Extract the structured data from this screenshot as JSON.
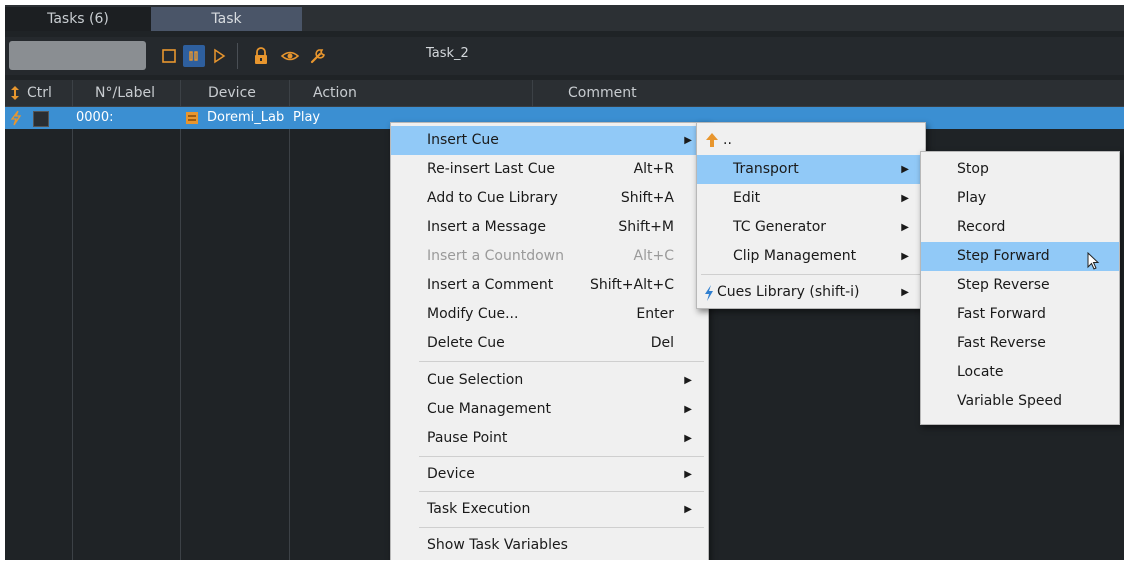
{
  "tabs": [
    "Tasks (6)",
    "Task"
  ],
  "toolbar": {
    "task_name": "Task_2"
  },
  "columns": {
    "ctrl": "Ctrl",
    "label": "N°/Label",
    "device": "Device",
    "action": "Action",
    "comment": "Comment"
  },
  "row": {
    "label": "0000:",
    "device": "Doremi_Lab",
    "action": "Play"
  },
  "context_menu": {
    "items": [
      {
        "label": "Insert Cue",
        "shortcut": ""
      },
      {
        "label": "Re-insert Last Cue",
        "shortcut": "Alt+R"
      },
      {
        "label": "Add to Cue Library",
        "shortcut": "Shift+A"
      },
      {
        "label": "Insert a Message",
        "shortcut": "Shift+M"
      },
      {
        "label": "Insert a Countdown",
        "shortcut": "Alt+C"
      },
      {
        "label": "Insert a Comment",
        "shortcut": "Shift+Alt+C"
      },
      {
        "label": "Modify Cue...",
        "shortcut": "Enter"
      },
      {
        "label": "Delete Cue",
        "shortcut": "Del"
      },
      {
        "label": "Cue Selection",
        "shortcut": ""
      },
      {
        "label": "Cue Management",
        "shortcut": ""
      },
      {
        "label": "Pause Point",
        "shortcut": ""
      },
      {
        "label": "Device",
        "shortcut": ""
      },
      {
        "label": "Task Execution",
        "shortcut": ""
      },
      {
        "label": "Show Task Variables",
        "shortcut": ""
      }
    ]
  },
  "insert_cue_menu": {
    "up_label": "..",
    "items": [
      "Transport",
      "Edit",
      "TC Generator",
      "Clip Management",
      "Cues Library (shift-i)"
    ]
  },
  "transport_menu": {
    "items": [
      "Stop",
      "Play",
      "Record",
      "Step Forward",
      "Step Reverse",
      "Fast Forward",
      "Fast Reverse",
      "Locate",
      "Variable Speed"
    ]
  },
  "colors": {
    "selection": "#3b8fd2",
    "menu_highlight": "#91c9f7",
    "accent_orange": "#e8962e"
  }
}
